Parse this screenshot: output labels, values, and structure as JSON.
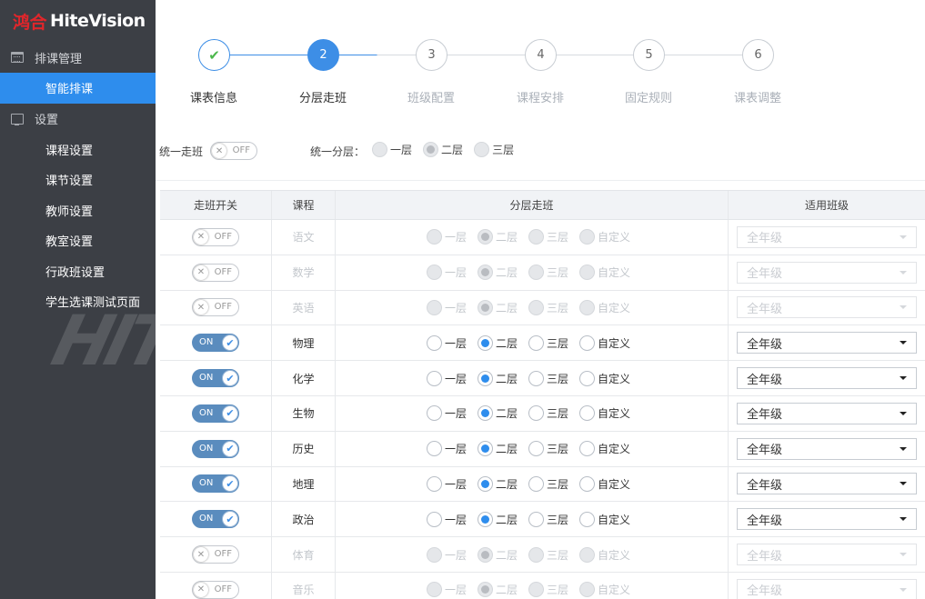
{
  "logo": {
    "cn": "鸿合",
    "en": "HiteVision"
  },
  "sidebar": {
    "group1": {
      "label": "排课管理",
      "icon": "calendar-icon"
    },
    "group1_items": [
      {
        "label": "智能排课",
        "active": true
      }
    ],
    "group2": {
      "label": "设置",
      "icon": "monitor-icon"
    },
    "group2_items": [
      {
        "label": "课程设置"
      },
      {
        "label": "课节设置"
      },
      {
        "label": "教师设置"
      },
      {
        "label": "教室设置"
      },
      {
        "label": "行政班设置"
      },
      {
        "label": "学生选课测试页面"
      }
    ],
    "watermark": "HIT"
  },
  "steps": [
    {
      "num": "✔",
      "label": "课表信息",
      "state": "done"
    },
    {
      "num": "2",
      "label": "分层走班",
      "state": "active"
    },
    {
      "num": "3",
      "label": "班级配置",
      "state": "todo"
    },
    {
      "num": "4",
      "label": "课程安排",
      "state": "todo"
    },
    {
      "num": "5",
      "label": "固定规则",
      "state": "todo"
    },
    {
      "num": "6",
      "label": "课表调整",
      "state": "todo"
    }
  ],
  "unified": {
    "walk_label": "统一走班",
    "toggle_off_text": "OFF",
    "layer_label": "统一分层：",
    "layer_options": [
      "一层",
      "二层",
      "三层"
    ],
    "layer_selected": 1
  },
  "table": {
    "headers": [
      "走班开关",
      "课程",
      "分层走班",
      "适用班级"
    ],
    "radio_options": [
      "一层",
      "二层",
      "三层",
      "自定义"
    ],
    "on_text": "ON",
    "off_text": "OFF",
    "rows": [
      {
        "course": "语文",
        "on": false,
        "selected": 1,
        "grade": "全年级"
      },
      {
        "course": "数学",
        "on": false,
        "selected": 1,
        "grade": "全年级"
      },
      {
        "course": "英语",
        "on": false,
        "selected": 1,
        "grade": "全年级"
      },
      {
        "course": "物理",
        "on": true,
        "selected": 1,
        "grade": "全年级"
      },
      {
        "course": "化学",
        "on": true,
        "selected": 1,
        "grade": "全年级"
      },
      {
        "course": "生物",
        "on": true,
        "selected": 1,
        "grade": "全年级"
      },
      {
        "course": "历史",
        "on": true,
        "selected": 1,
        "grade": "全年级"
      },
      {
        "course": "地理",
        "on": true,
        "selected": 1,
        "grade": "全年级"
      },
      {
        "course": "政治",
        "on": true,
        "selected": 1,
        "grade": "全年级"
      },
      {
        "course": "体育",
        "on": false,
        "selected": 1,
        "grade": "全年级"
      },
      {
        "course": "音乐",
        "on": false,
        "selected": 1,
        "grade": "全年级"
      }
    ]
  },
  "colors": {
    "accent": "#2e8ded",
    "sidebar": "#3c3f45",
    "logo_red": "#e0262b",
    "toggle_on": "#5a8cbe"
  }
}
